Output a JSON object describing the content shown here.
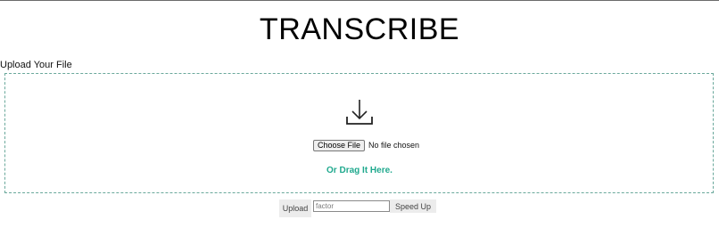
{
  "page": {
    "title": "TRANSCRIBE"
  },
  "upload_section": {
    "label": "Upload Your File",
    "dropzone": {
      "icon": "download-icon",
      "choose_file_label": "Choose File",
      "file_status": "No file chosen",
      "drag_hint": "Or Drag It Here."
    }
  },
  "controls": {
    "upload_label": "Upload",
    "factor_placeholder": "factor",
    "speed_up_label": "Speed Up"
  },
  "colors": {
    "accent": "#20a98e",
    "dropzone_border": "#6aa89b",
    "button_bg": "#ececec"
  }
}
